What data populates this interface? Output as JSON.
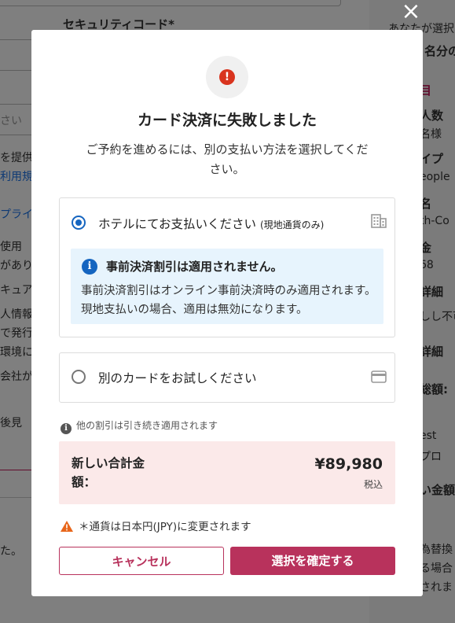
{
  "background": {
    "security_code_label": "セキュリティコード",
    "required_mark": "*",
    "left_fragments": [
      "さい",
      "を提供",
      "利用規",
      "プライ",
      "使用",
      "があり",
      "キュア",
      "人情報",
      "で発行",
      "環境に",
      "会社が",
      "後見",
      "た。"
    ],
    "right_fragments": [
      "あなたが選択",
      "名分の",
      "目",
      "人数",
      "名様",
      "イプ",
      "eople",
      "名",
      "th-Co",
      "金",
      "68",
      "詳細",
      "しし不可",
      "詳細",
      "総額:",
      "est",
      "プロ",
      "い金額",
      "為替換",
      "る場合",
      "されま"
    ]
  },
  "modal": {
    "close_icon": "×",
    "alert_icon": "!",
    "title": "カード決済に失敗しました",
    "subtitle": "ご予約を進めるには、別の支払い方法を選択してください。",
    "option_hotel": {
      "label": "ホテルにてお支払いください",
      "sub_label": "(現地通貨のみ)",
      "selected": true,
      "icon": "building-icon"
    },
    "info": {
      "icon": "i",
      "title": "事前決済割引は適用されません。",
      "body": "事前決済割引はオンライン事前決済時のみ適用されます。現地支払いの場合、適用は無効になります。"
    },
    "option_card": {
      "label": "別のカードをお試しください",
      "selected": false,
      "icon": "credit-card-icon"
    },
    "note": {
      "icon": "i",
      "text": "他の割引は引き続き適用されます"
    },
    "total": {
      "label": "新しい合計金額：",
      "value": "¥89,980",
      "tax_note": "税込"
    },
    "warning": {
      "icon": "warning-icon",
      "text": "＊通貨は日本円(JPY)に変更されます"
    },
    "buttons": {
      "cancel": "キャンセル",
      "confirm": "選択を確定する"
    }
  }
}
